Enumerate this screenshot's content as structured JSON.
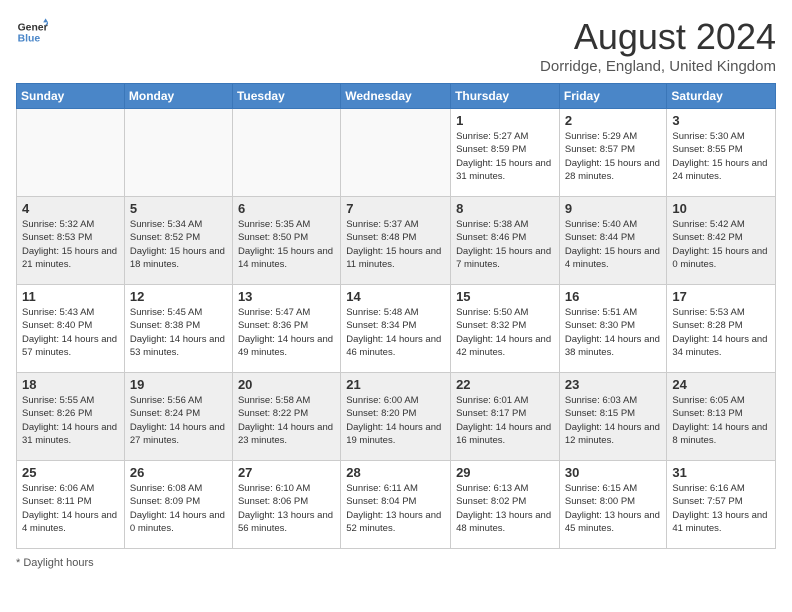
{
  "header": {
    "logo_line1": "General",
    "logo_line2": "Blue",
    "month_title": "August 2024",
    "location": "Dorridge, England, United Kingdom"
  },
  "days_of_week": [
    "Sunday",
    "Monday",
    "Tuesday",
    "Wednesday",
    "Thursday",
    "Friday",
    "Saturday"
  ],
  "footer": {
    "note": "Daylight hours"
  },
  "weeks": [
    {
      "cells": [
        {
          "day": "",
          "empty": true
        },
        {
          "day": "",
          "empty": true
        },
        {
          "day": "",
          "empty": true
        },
        {
          "day": "",
          "empty": true
        },
        {
          "day": "1",
          "sunrise": "5:27 AM",
          "sunset": "8:59 PM",
          "daylight": "15 hours and 31 minutes."
        },
        {
          "day": "2",
          "sunrise": "5:29 AM",
          "sunset": "8:57 PM",
          "daylight": "15 hours and 28 minutes."
        },
        {
          "day": "3",
          "sunrise": "5:30 AM",
          "sunset": "8:55 PM",
          "daylight": "15 hours and 24 minutes."
        }
      ]
    },
    {
      "cells": [
        {
          "day": "4",
          "sunrise": "5:32 AM",
          "sunset": "8:53 PM",
          "daylight": "15 hours and 21 minutes."
        },
        {
          "day": "5",
          "sunrise": "5:34 AM",
          "sunset": "8:52 PM",
          "daylight": "15 hours and 18 minutes."
        },
        {
          "day": "6",
          "sunrise": "5:35 AM",
          "sunset": "8:50 PM",
          "daylight": "15 hours and 14 minutes."
        },
        {
          "day": "7",
          "sunrise": "5:37 AM",
          "sunset": "8:48 PM",
          "daylight": "15 hours and 11 minutes."
        },
        {
          "day": "8",
          "sunrise": "5:38 AM",
          "sunset": "8:46 PM",
          "daylight": "15 hours and 7 minutes."
        },
        {
          "day": "9",
          "sunrise": "5:40 AM",
          "sunset": "8:44 PM",
          "daylight": "15 hours and 4 minutes."
        },
        {
          "day": "10",
          "sunrise": "5:42 AM",
          "sunset": "8:42 PM",
          "daylight": "15 hours and 0 minutes."
        }
      ]
    },
    {
      "cells": [
        {
          "day": "11",
          "sunrise": "5:43 AM",
          "sunset": "8:40 PM",
          "daylight": "14 hours and 57 minutes."
        },
        {
          "day": "12",
          "sunrise": "5:45 AM",
          "sunset": "8:38 PM",
          "daylight": "14 hours and 53 minutes."
        },
        {
          "day": "13",
          "sunrise": "5:47 AM",
          "sunset": "8:36 PM",
          "daylight": "14 hours and 49 minutes."
        },
        {
          "day": "14",
          "sunrise": "5:48 AM",
          "sunset": "8:34 PM",
          "daylight": "14 hours and 46 minutes."
        },
        {
          "day": "15",
          "sunrise": "5:50 AM",
          "sunset": "8:32 PM",
          "daylight": "14 hours and 42 minutes."
        },
        {
          "day": "16",
          "sunrise": "5:51 AM",
          "sunset": "8:30 PM",
          "daylight": "14 hours and 38 minutes."
        },
        {
          "day": "17",
          "sunrise": "5:53 AM",
          "sunset": "8:28 PM",
          "daylight": "14 hours and 34 minutes."
        }
      ]
    },
    {
      "cells": [
        {
          "day": "18",
          "sunrise": "5:55 AM",
          "sunset": "8:26 PM",
          "daylight": "14 hours and 31 minutes."
        },
        {
          "day": "19",
          "sunrise": "5:56 AM",
          "sunset": "8:24 PM",
          "daylight": "14 hours and 27 minutes."
        },
        {
          "day": "20",
          "sunrise": "5:58 AM",
          "sunset": "8:22 PM",
          "daylight": "14 hours and 23 minutes."
        },
        {
          "day": "21",
          "sunrise": "6:00 AM",
          "sunset": "8:20 PM",
          "daylight": "14 hours and 19 minutes."
        },
        {
          "day": "22",
          "sunrise": "6:01 AM",
          "sunset": "8:17 PM",
          "daylight": "14 hours and 16 minutes."
        },
        {
          "day": "23",
          "sunrise": "6:03 AM",
          "sunset": "8:15 PM",
          "daylight": "14 hours and 12 minutes."
        },
        {
          "day": "24",
          "sunrise": "6:05 AM",
          "sunset": "8:13 PM",
          "daylight": "14 hours and 8 minutes."
        }
      ]
    },
    {
      "cells": [
        {
          "day": "25",
          "sunrise": "6:06 AM",
          "sunset": "8:11 PM",
          "daylight": "14 hours and 4 minutes."
        },
        {
          "day": "26",
          "sunrise": "6:08 AM",
          "sunset": "8:09 PM",
          "daylight": "14 hours and 0 minutes."
        },
        {
          "day": "27",
          "sunrise": "6:10 AM",
          "sunset": "8:06 PM",
          "daylight": "13 hours and 56 minutes."
        },
        {
          "day": "28",
          "sunrise": "6:11 AM",
          "sunset": "8:04 PM",
          "daylight": "13 hours and 52 minutes."
        },
        {
          "day": "29",
          "sunrise": "6:13 AM",
          "sunset": "8:02 PM",
          "daylight": "13 hours and 48 minutes."
        },
        {
          "day": "30",
          "sunrise": "6:15 AM",
          "sunset": "8:00 PM",
          "daylight": "13 hours and 45 minutes."
        },
        {
          "day": "31",
          "sunrise": "6:16 AM",
          "sunset": "7:57 PM",
          "daylight": "13 hours and 41 minutes."
        }
      ]
    }
  ]
}
